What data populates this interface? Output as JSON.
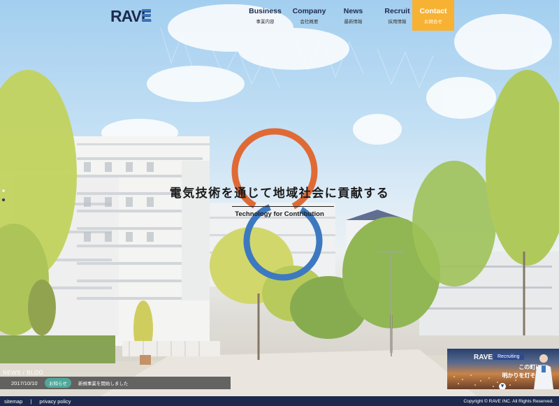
{
  "brand": {
    "logo_text": "RAVE"
  },
  "nav": {
    "items": [
      {
        "en": "Business",
        "ja": "事業内容"
      },
      {
        "en": "Company",
        "ja": "会社概要"
      },
      {
        "en": "News",
        "ja": "最新情報"
      },
      {
        "en": "Recruit",
        "ja": "採用情報"
      }
    ],
    "contact": {
      "en": "Contact",
      "ja": "お問合せ"
    }
  },
  "hero": {
    "headline_ja": "電気技術を通じて地域社会に貢献する",
    "headline_en": "Technology for Contribution"
  },
  "news": {
    "section_label": "NEWS / BLOG",
    "latest": {
      "date": "2017/10/10",
      "category": "お知らせ",
      "title": "新規事業を開始しました"
    }
  },
  "recruit_banner": {
    "logo": "RAVE",
    "tag": "Recruiting",
    "copy_line1": "この町に、",
    "copy_line2": "明かりを灯そう。"
  },
  "footer": {
    "links": [
      "sitemap",
      "privacy policy"
    ],
    "separator": "|",
    "copyright": "Copyright © RAVE INC. All Rights Reserved."
  },
  "colors": {
    "navy": "#1d2a4e",
    "contact_orange": "#f7b233",
    "ring_orange": "#e06a35",
    "ring_blue": "#3d79c0",
    "badge_teal": "#4fa89a"
  }
}
